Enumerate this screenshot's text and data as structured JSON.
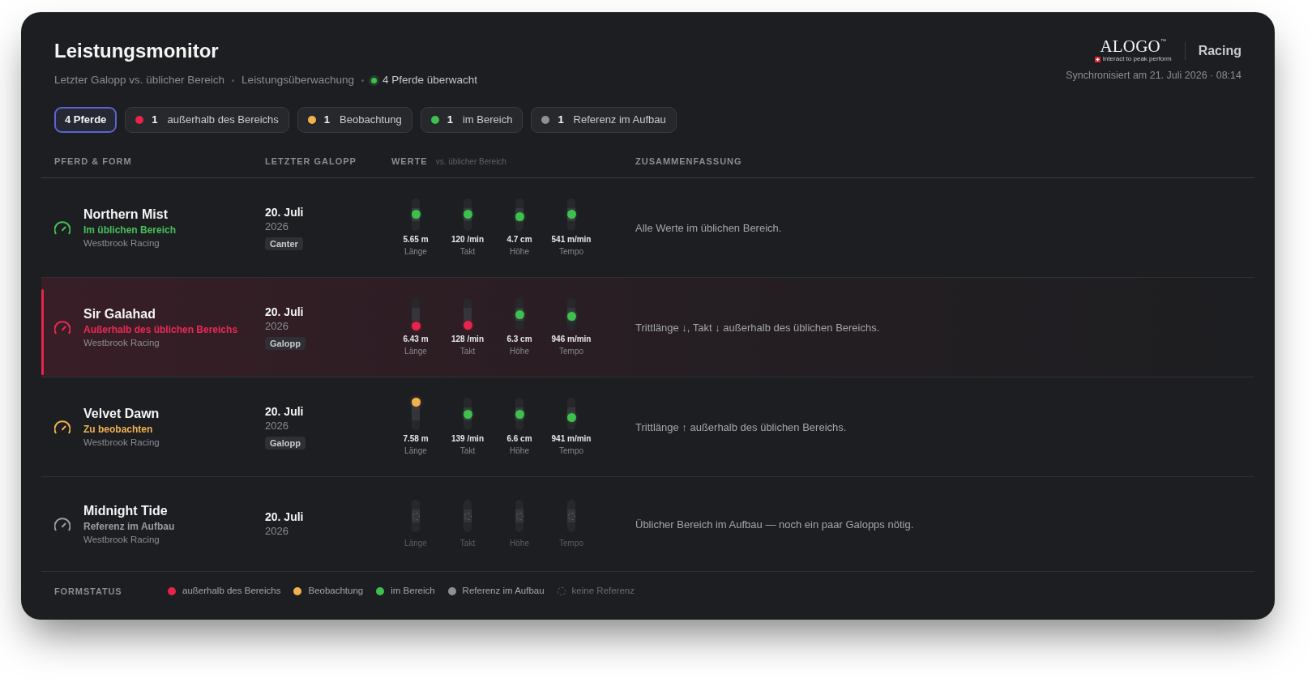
{
  "header": {
    "title": "Leistungsmonitor",
    "subtitle": [
      "Letzter Galopp vs. üblicher Bereich",
      "Leistungsüberwachung"
    ],
    "monitoring": {
      "text": "4 Pferde überwacht",
      "live": true
    },
    "brand": {
      "name": "ALOGO",
      "mark": "™",
      "tagline": "Interact to peak perform",
      "product": "Racing"
    },
    "sync": "Synchronisiert am 21. Juli 2026 · 08:14"
  },
  "filters": [
    {
      "kind": "total",
      "label": "4 Pferde",
      "selected": true
    },
    {
      "kind": "status",
      "count": "1",
      "label": "außerhalb des Bereichs",
      "color": "#e8234c",
      "selected": false
    },
    {
      "kind": "status",
      "count": "1",
      "label": "Beobachtung",
      "color": "#f2b150",
      "selected": false
    },
    {
      "kind": "status",
      "count": "1",
      "label": "im Bereich",
      "color": "#3fbf4f",
      "selected": false
    },
    {
      "kind": "status",
      "count": "1",
      "label": "Referenz im Aufbau",
      "color": "#8e9096",
      "selected": false
    }
  ],
  "table": {
    "columns": [
      {
        "label": "PFERD & FORM"
      },
      {
        "label": "LETZTER GALOPP"
      },
      {
        "label": "WERTE",
        "note": "vs. üblicher Bereich"
      },
      {
        "label": "ZUSAMMENFASSUNG"
      }
    ],
    "rows": [
      {
        "name": "Northern Mist",
        "kind": "in_range",
        "status": "Im üblichen Bereich",
        "owner": "Westbrook Racing",
        "date": "20. Juli",
        "year": "2026",
        "gait": "Canter",
        "metrics": [
          {
            "kind": "dot",
            "value": "5.65 m",
            "label": "Länge",
            "color": "#3fbf4f",
            "level": 0.51
          },
          {
            "kind": "dot",
            "value": "120 /min",
            "label": "Takt",
            "color": "#3fbf4f",
            "level": 0.51
          },
          {
            "kind": "dot",
            "value": "4.7 cm",
            "label": "Höhe",
            "color": "#3fbf4f",
            "level": 0.42
          },
          {
            "kind": "dot",
            "value": "541 m/min",
            "label": "Tempo",
            "color": "#3fbf4f",
            "level": 0.53
          }
        ],
        "summary": "Alle Werte im üblichen Bereich."
      },
      {
        "name": "Sir Galahad",
        "kind": "out_of_range",
        "status": "Außerhalb des üblichen Bereichs",
        "owner": "Westbrook Racing",
        "date": "20. Juli",
        "year": "2026",
        "gait": "Galopp",
        "metrics": [
          {
            "kind": "dot",
            "value": "6.43 m",
            "label": "Länge",
            "color": "#e8234c",
            "level": 0
          },
          {
            "kind": "dot",
            "value": "128 /min",
            "label": "Takt",
            "color": "#e8234c",
            "level": 0.03
          },
          {
            "kind": "dot",
            "value": "6.3 cm",
            "label": "Höhe",
            "color": "#3fbf4f",
            "level": 0.47
          },
          {
            "kind": "dot",
            "value": "946 m/min",
            "label": "Tempo",
            "color": "#3fbf4f",
            "level": 0.43
          }
        ],
        "summary": "Trittlänge ↓, Takt ↓ außerhalb des üblichen Bereichs."
      },
      {
        "name": "Velvet Dawn",
        "kind": "watch",
        "status": "Zu beobachten",
        "owner": "Westbrook Racing",
        "date": "20. Juli",
        "year": "2026",
        "gait": "Galopp",
        "metrics": [
          {
            "kind": "dot",
            "value": "7.58 m",
            "label": "Länge",
            "color": "#f2b150",
            "level": 1
          },
          {
            "kind": "dot",
            "value": "139 /min",
            "label": "Takt",
            "color": "#3fbf4f",
            "level": 0.5
          },
          {
            "kind": "dot",
            "value": "6.6 cm",
            "label": "Höhe",
            "color": "#3fbf4f",
            "level": 0.5
          },
          {
            "kind": "dot",
            "value": "941 m/min",
            "label": "Tempo",
            "color": "#3fbf4f",
            "level": 0.36
          }
        ],
        "summary": "Trittlänge ↑ außerhalb des üblichen Bereichs."
      },
      {
        "name": "Midnight Tide",
        "kind": "building",
        "status": "Referenz im Aufbau",
        "owner": "Westbrook Racing",
        "date": "20. Juli",
        "year": "2026",
        "metrics": [
          {
            "kind": "empty",
            "label": "Länge"
          },
          {
            "kind": "empty",
            "label": "Takt"
          },
          {
            "kind": "empty",
            "label": "Höhe"
          },
          {
            "kind": "empty",
            "label": "Tempo"
          }
        ],
        "summary": "Üblicher Bereich im Aufbau — noch ein paar Galopps nötig."
      }
    ]
  },
  "legend": {
    "title": "FORMSTATUS",
    "items": [
      {
        "kind": "dot",
        "label": "außerhalb des Bereichs",
        "color": "#e8234c"
      },
      {
        "kind": "dot",
        "label": "Beobachtung",
        "color": "#f2b150"
      },
      {
        "kind": "dot",
        "label": "im Bereich",
        "color": "#3fbf4f"
      },
      {
        "kind": "dot",
        "label": "Referenz im Aufbau",
        "color": "#8e9096"
      },
      {
        "kind": "ring",
        "label": "keine Referenz"
      }
    ]
  }
}
